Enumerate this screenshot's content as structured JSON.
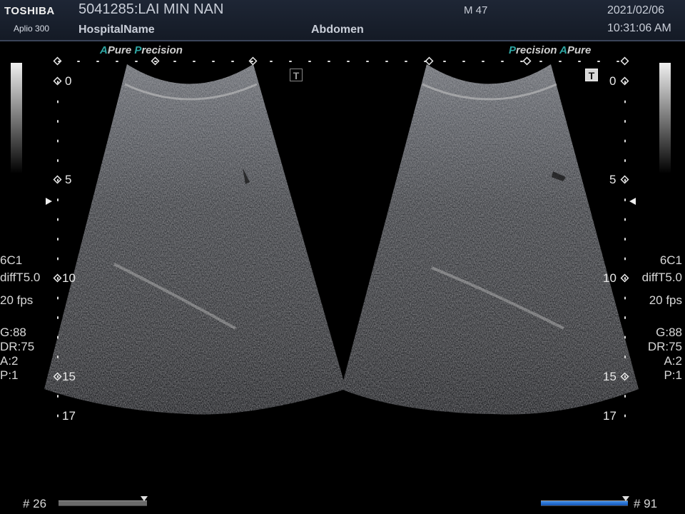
{
  "header": {
    "brand": "TOSHIBA",
    "model": "Aplio 300",
    "patient": "5041285:LAI MIN NAN",
    "hospital": "HospitalName",
    "exam": "Abdomen",
    "sex_age": "M 47",
    "date": "2021/02/06",
    "time": "10:31:06 AM"
  },
  "left_image": {
    "tech": {
      "a": "A",
      "pure": "Pure",
      "p": "P",
      "recision": "recision"
    },
    "depth_ticks": [
      "0",
      "5",
      "10",
      "15",
      "17"
    ],
    "params": [
      "6C1",
      "diffT5.0",
      "20 fps",
      "G:88",
      "DR:75",
      "A:2",
      "P:1"
    ],
    "frame": "# 26",
    "cine_fraction": 1.0,
    "t_badge": "T",
    "active": false
  },
  "right_image": {
    "tech": {
      "p": "P",
      "recision": "recision",
      "a": "A",
      "pure": "Pure"
    },
    "depth_ticks": [
      "0",
      "5",
      "10",
      "15",
      "17"
    ],
    "params": [
      "6C1",
      "diffT5.0",
      "20 fps",
      "G:88",
      "DR:75",
      "A:2",
      "P:1"
    ],
    "frame": "# 91",
    "cine_fraction": 1.0,
    "t_badge": "T",
    "active": true
  },
  "colors": {
    "header_bg": "#1a2130",
    "accent_teal": "#2fa7a4",
    "active_bar": "#1e6fd0",
    "inactive_bar": "#6a6a6a"
  }
}
